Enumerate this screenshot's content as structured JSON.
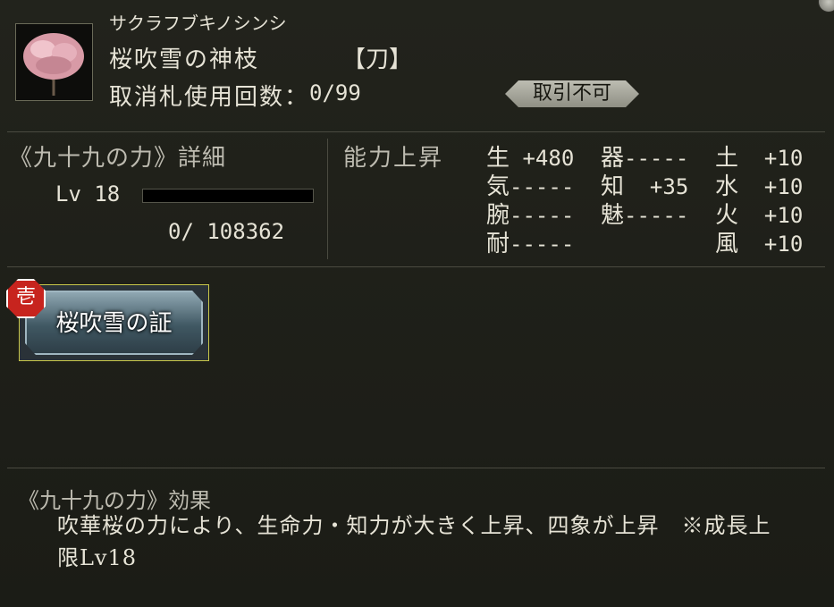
{
  "item": {
    "kana": "サクラフブキノシンシ",
    "name": "桜吹雪の神枝",
    "type": "【刀】",
    "usage_label": "取消札使用回数：",
    "usage_value": "0/99",
    "trade": "取引不可"
  },
  "detail": {
    "title": "《九十九の力》詳細",
    "level_text": "Lv 18",
    "xp_text": "0/   108362",
    "xp_fraction": 0
  },
  "ability": {
    "title": "能力上昇",
    "stats": [
      {
        "label": "生",
        "value": " +480"
      },
      {
        "label": "器",
        "value": "-----"
      },
      {
        "label": "土",
        "value": "  +10"
      },
      {
        "label": "気",
        "value": "-----"
      },
      {
        "label": "知",
        "value": "  +35"
      },
      {
        "label": "水",
        "value": "  +10"
      },
      {
        "label": "腕",
        "value": "-----"
      },
      {
        "label": "魅",
        "value": "-----"
      },
      {
        "label": "火",
        "value": "  +10"
      },
      {
        "label": "耐",
        "value": "-----"
      },
      {
        "label": "風",
        "value": "  +10"
      }
    ]
  },
  "card": {
    "rank": "壱",
    "label": "桜吹雪の証"
  },
  "effect": {
    "title": "《九十九の力》効果",
    "text": "吹華桜の力により、生命力・知力が大きく上昇、四象が上昇　※成長上限Lv18"
  },
  "colors": {
    "background": "#1d1e18",
    "badge": "#bdbdb2",
    "rank_red": "#c7241e",
    "card_border": "#c9c84a"
  }
}
